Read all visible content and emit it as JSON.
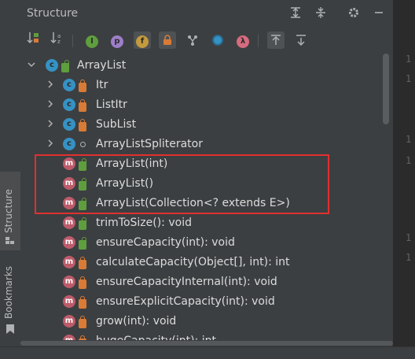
{
  "header": {
    "title": "Structure"
  },
  "sidebar": {
    "structure_tab": "Structure",
    "bookmarks_tab": "Bookmarks"
  },
  "editor": {
    "line_numbers": [
      "1",
      "1",
      "1",
      "1",
      "1",
      "1"
    ]
  },
  "toolbar": {
    "sort_visibility_icon": "sort-by-visibility-icon",
    "sort_alpha_icon": "sort-alphabetically-icon",
    "inherited_label": "I",
    "properties_label": "p",
    "fields_label": "f",
    "nonpublic_icon": "lock-icon",
    "anonymous_icon": "anonymous-classes-icon",
    "lambdas_label": "λ"
  },
  "tree": {
    "root": {
      "label": "ArrayList",
      "icon": "c"
    },
    "items": [
      {
        "label": "Itr",
        "icon": "c"
      },
      {
        "label": "ListItr",
        "icon": "c"
      },
      {
        "label": "SubList",
        "icon": "c"
      },
      {
        "label": "ArrayListSpliterator",
        "icon": "c"
      },
      {
        "label": "ArrayList(int)",
        "icon": "m"
      },
      {
        "label": "ArrayList()",
        "icon": "m"
      },
      {
        "label": "ArrayList(Collection<? extends E>)",
        "icon": "m"
      },
      {
        "label": "trimToSize(): void",
        "icon": "m"
      },
      {
        "label": "ensureCapacity(int): void",
        "icon": "m"
      },
      {
        "label": "calculateCapacity(Object[], int): int",
        "icon": "m"
      },
      {
        "label": "ensureCapacityInternal(int): void",
        "icon": "m"
      },
      {
        "label": "ensureExplicitCapacity(int): void",
        "icon": "m"
      },
      {
        "label": "grow(int): void",
        "icon": "m"
      },
      {
        "label": "hugeCapacity(int): int",
        "icon": "m"
      }
    ]
  },
  "colors": {
    "highlight_border": "#e03030",
    "class_icon": "#3592c4",
    "method_icon": "#bd5b6a"
  }
}
